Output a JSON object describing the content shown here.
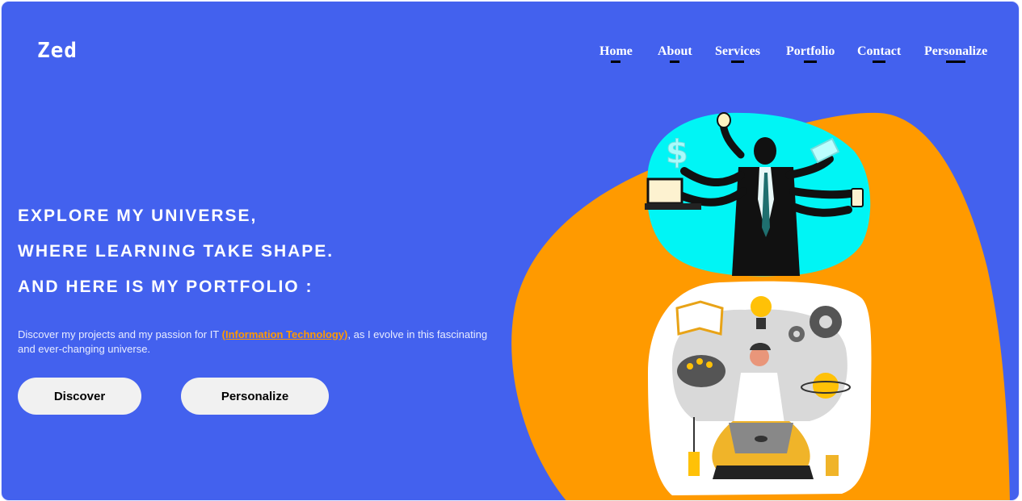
{
  "logo": "Zed",
  "nav": [
    {
      "label": "Home"
    },
    {
      "label": "About"
    },
    {
      "label": "Services"
    },
    {
      "label": "Portfolio"
    },
    {
      "label": "Contact"
    },
    {
      "label": "Personalize"
    }
  ],
  "hero": {
    "lines": [
      "EXPLORE MY UNIVERSE,",
      "WHERE LEARNING TAKE SHAPE.",
      "AND HERE IS MY PORTFOLIO :"
    ],
    "description_before": "Discover my projects and my passion for IT ",
    "description_highlight": "(Information Technology)",
    "description_after": ", as I evolve in this fascinating and ever-changing universe."
  },
  "buttons": {
    "discover": "Discover",
    "personalize": "Personalize"
  },
  "colors": {
    "background": "#4361ee",
    "accent": "#ff9a00",
    "cyan": "#00f5f5"
  }
}
